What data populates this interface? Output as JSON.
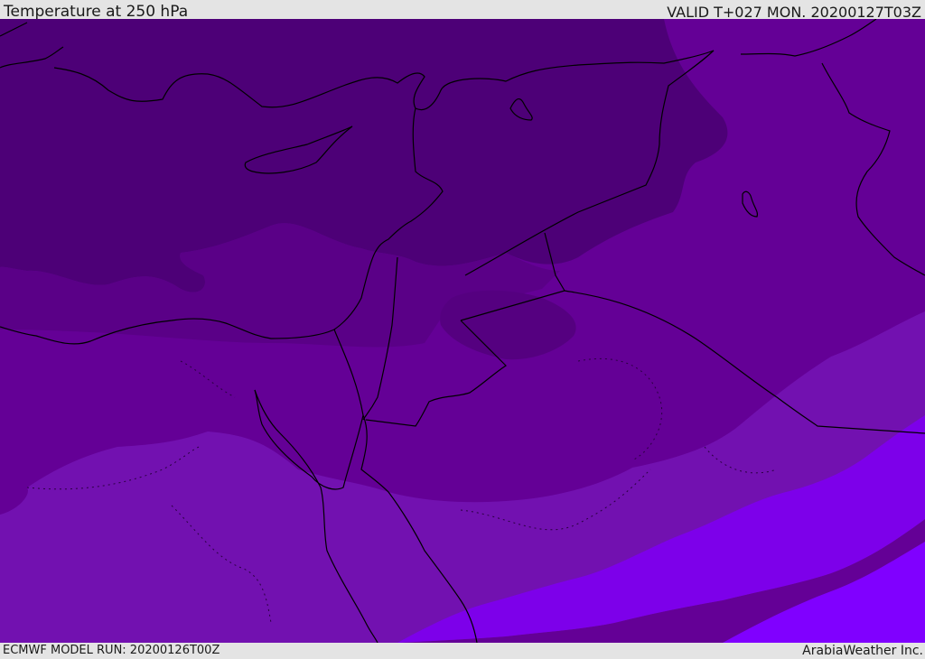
{
  "header": {
    "title": "Temperature at 250 hPa",
    "valid": "VALID T+027 MON. 20200127T03Z"
  },
  "footer": {
    "model_run": "ECMWF MODEL RUN: 20200126T00Z",
    "credit": "ArabiaWeather Inc."
  },
  "map": {
    "fill_colors": [
      "#4d0077",
      "#5a0087",
      "#640096",
      "#7211b0",
      "#7d00ea",
      "#8000ff"
    ],
    "coastline_color": "#000000"
  }
}
